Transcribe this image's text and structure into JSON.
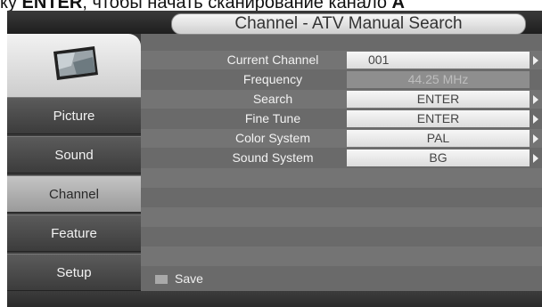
{
  "instruction": {
    "prefix": "ку ",
    "key": "ENTER",
    "suffix": ", чтобы начать сканирование канало",
    "tail": "A"
  },
  "title": "Channel - ATV Manual Search",
  "sidebar": {
    "items": [
      {
        "label": "Picture"
      },
      {
        "label": "Sound"
      },
      {
        "label": "Channel"
      },
      {
        "label": "Feature"
      },
      {
        "label": "Setup"
      }
    ],
    "active": "Channel"
  },
  "settings": {
    "current_channel": {
      "label": "Current Channel",
      "value": "001"
    },
    "frequency": {
      "label": "Frequency",
      "value": "44.25  MHz"
    },
    "search": {
      "label": "Search",
      "value": "ENTER"
    },
    "fine_tune": {
      "label": "Fine Tune",
      "value": "ENTER"
    },
    "color_system": {
      "label": "Color System",
      "value": "PAL"
    },
    "sound_system": {
      "label": "Sound System",
      "value": "BG"
    }
  },
  "save_label": "Save",
  "icons": {
    "tv": "tv-picture-icon",
    "save": "save-square-icon",
    "arrow": "chevron-right-icon"
  }
}
